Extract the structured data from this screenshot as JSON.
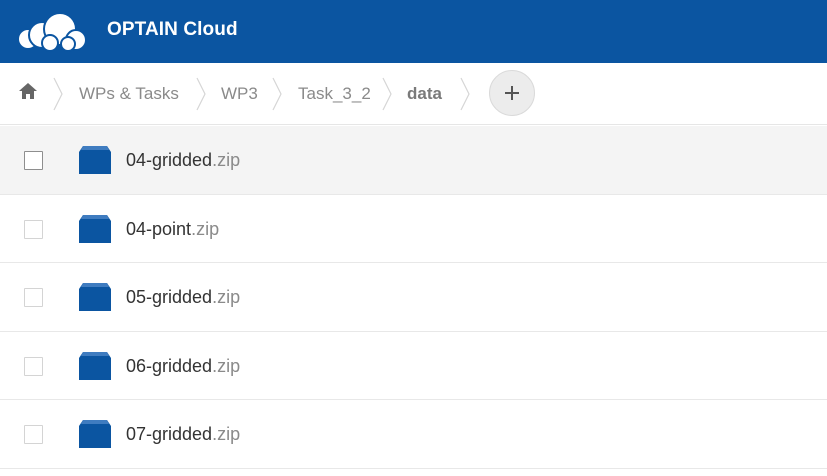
{
  "colors": {
    "brand": "#0b55a1",
    "icon_blue": "#0b55a1"
  },
  "header": {
    "logo_icon": "cloud-logo-icon",
    "title": "OPTAIN Cloud"
  },
  "breadcrumb": {
    "home_icon": "home-icon",
    "items": [
      {
        "label": "WPs & Tasks"
      },
      {
        "label": "WP3"
      },
      {
        "label": "Task_3_2"
      },
      {
        "label": "data"
      }
    ],
    "add_icon": "plus-icon"
  },
  "files": [
    {
      "base": "04-gridded",
      "ext": ".zip",
      "selected_row": true
    },
    {
      "base": "04-point",
      "ext": ".zip",
      "selected_row": false
    },
    {
      "base": "05-gridded",
      "ext": ".zip",
      "selected_row": false
    },
    {
      "base": "06-gridded",
      "ext": ".zip",
      "selected_row": false
    },
    {
      "base": "07-gridded",
      "ext": ".zip",
      "selected_row": false
    }
  ]
}
